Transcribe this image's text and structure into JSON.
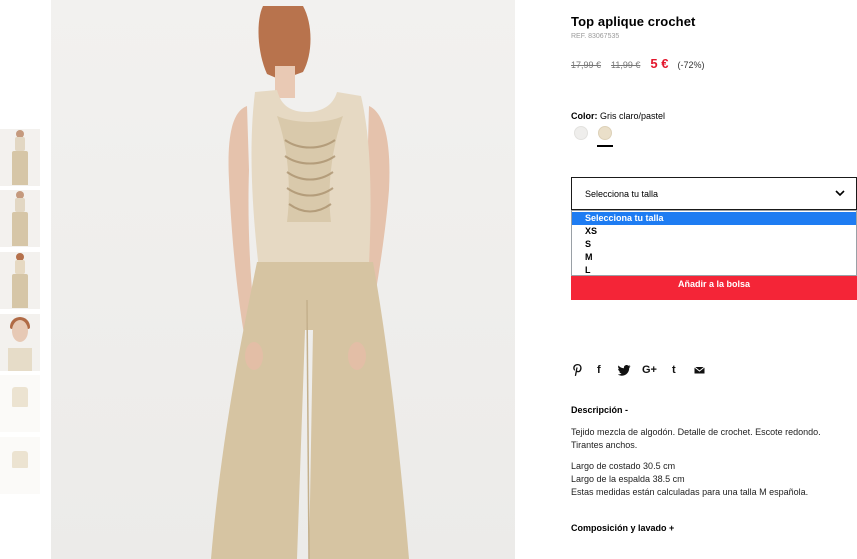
{
  "product": {
    "title": "Top aplique crochet",
    "ref": "REF. 83067535",
    "price_original": "17,99 €",
    "price_previous": "11,99 €",
    "price_current": "5 €",
    "discount": "(-72%)"
  },
  "color": {
    "label": "Color:",
    "value": "Gris claro/pastel",
    "swatches": [
      "#efeeec",
      "#eadfc9"
    ],
    "selected_index": 1
  },
  "size": {
    "selected": "Selecciona tu talla",
    "options": [
      "Selecciona tu talla",
      "XS",
      "S",
      "M",
      "L"
    ]
  },
  "cart": {
    "add_label": "Añadir a la bolsa",
    "accent": "#f42537"
  },
  "share": {
    "icons": [
      "pinterest-icon",
      "facebook-icon",
      "twitter-icon",
      "google-plus-icon",
      "tumblr-icon",
      "email-icon"
    ],
    "facebook": "f",
    "googleplus": "G+",
    "tumblr": "t"
  },
  "description": {
    "heading": "Descripción -",
    "para1": "Tejido mezcla de algodón. Detalle de crochet. Escote redondo. Tirantes anchos.",
    "line1": "Largo de costado 30.5 cm",
    "line2": "Largo de la espalda 38.5 cm",
    "line3": "Estas medidas están calculadas para una talla M española."
  },
  "composition": {
    "heading": "Composición y lavado +"
  },
  "colors": {
    "price_red": "#e3162c",
    "option_highlight": "#1e7cf2"
  }
}
